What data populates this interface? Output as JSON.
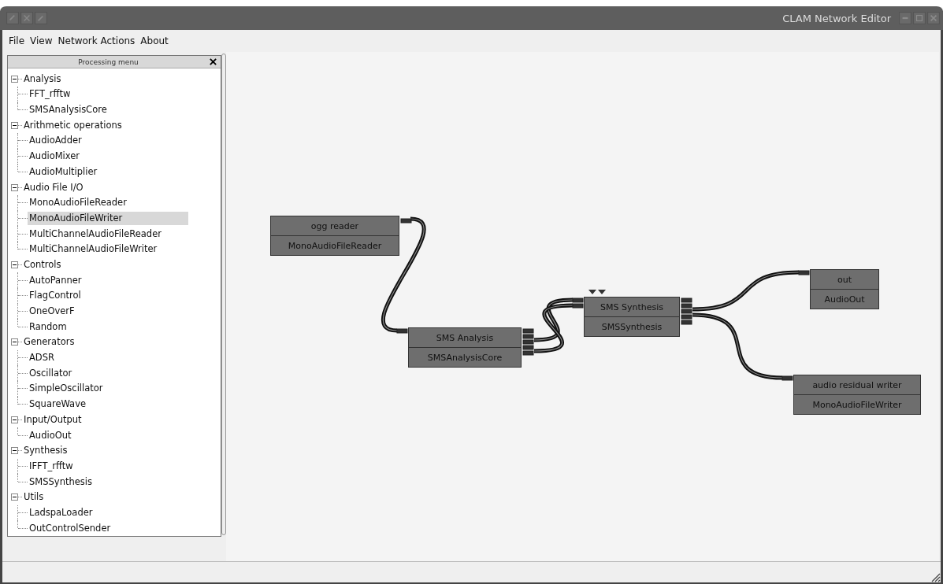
{
  "window": {
    "title": "CLAM Network Editor"
  },
  "menu": [
    "File",
    "View",
    "Network Actions",
    "About"
  ],
  "panel": {
    "title": "Processing menu"
  },
  "tree": [
    {
      "label": "Analysis",
      "expanded": true,
      "children": [
        {
          "label": "FFT_rfftw",
          "selected": false
        },
        {
          "label": "SMSAnalysisCore",
          "selected": false
        }
      ]
    },
    {
      "label": "Arithmetic operations",
      "expanded": true,
      "children": [
        {
          "label": "AudioAdder",
          "selected": false
        },
        {
          "label": "AudioMixer",
          "selected": false
        },
        {
          "label": "AudioMultiplier",
          "selected": false
        }
      ]
    },
    {
      "label": "Audio File I/O",
      "expanded": true,
      "children": [
        {
          "label": "MonoAudioFileReader",
          "selected": false
        },
        {
          "label": "MonoAudioFileWriter",
          "selected": true
        },
        {
          "label": "MultiChannelAudioFileReader",
          "selected": false
        },
        {
          "label": "MultiChannelAudioFileWriter",
          "selected": false
        }
      ]
    },
    {
      "label": "Controls",
      "expanded": true,
      "children": [
        {
          "label": "AutoPanner",
          "selected": false
        },
        {
          "label": "FlagControl",
          "selected": false
        },
        {
          "label": "OneOverF",
          "selected": false
        },
        {
          "label": "Random",
          "selected": false
        }
      ]
    },
    {
      "label": "Generators",
      "expanded": true,
      "children": [
        {
          "label": "ADSR",
          "selected": false
        },
        {
          "label": "Oscillator",
          "selected": false
        },
        {
          "label": "SimpleOscillator",
          "selected": false
        },
        {
          "label": "SquareWave",
          "selected": false
        }
      ]
    },
    {
      "label": "Input/Output",
      "expanded": true,
      "children": [
        {
          "label": "AudioOut",
          "selected": false
        }
      ]
    },
    {
      "label": "Synthesis",
      "expanded": true,
      "children": [
        {
          "label": "IFFT_rfftw",
          "selected": false
        },
        {
          "label": "SMSSynthesis",
          "selected": false
        }
      ]
    },
    {
      "label": "Utils",
      "expanded": true,
      "children": [
        {
          "label": "LadspaLoader",
          "selected": false
        },
        {
          "label": "OutControlSender",
          "selected": false
        }
      ]
    }
  ],
  "nodes": [
    {
      "name": "ogg reader",
      "type": "MonoAudioFileReader"
    },
    {
      "name": "SMS Analysis",
      "type": "SMSAnalysisCore"
    },
    {
      "name": "SMS Synthesis",
      "type": "SMSSynthesis"
    },
    {
      "name": "out",
      "type": "AudioOut"
    },
    {
      "name": "audio residual writer",
      "type": "MonoAudioFileWriter"
    }
  ]
}
